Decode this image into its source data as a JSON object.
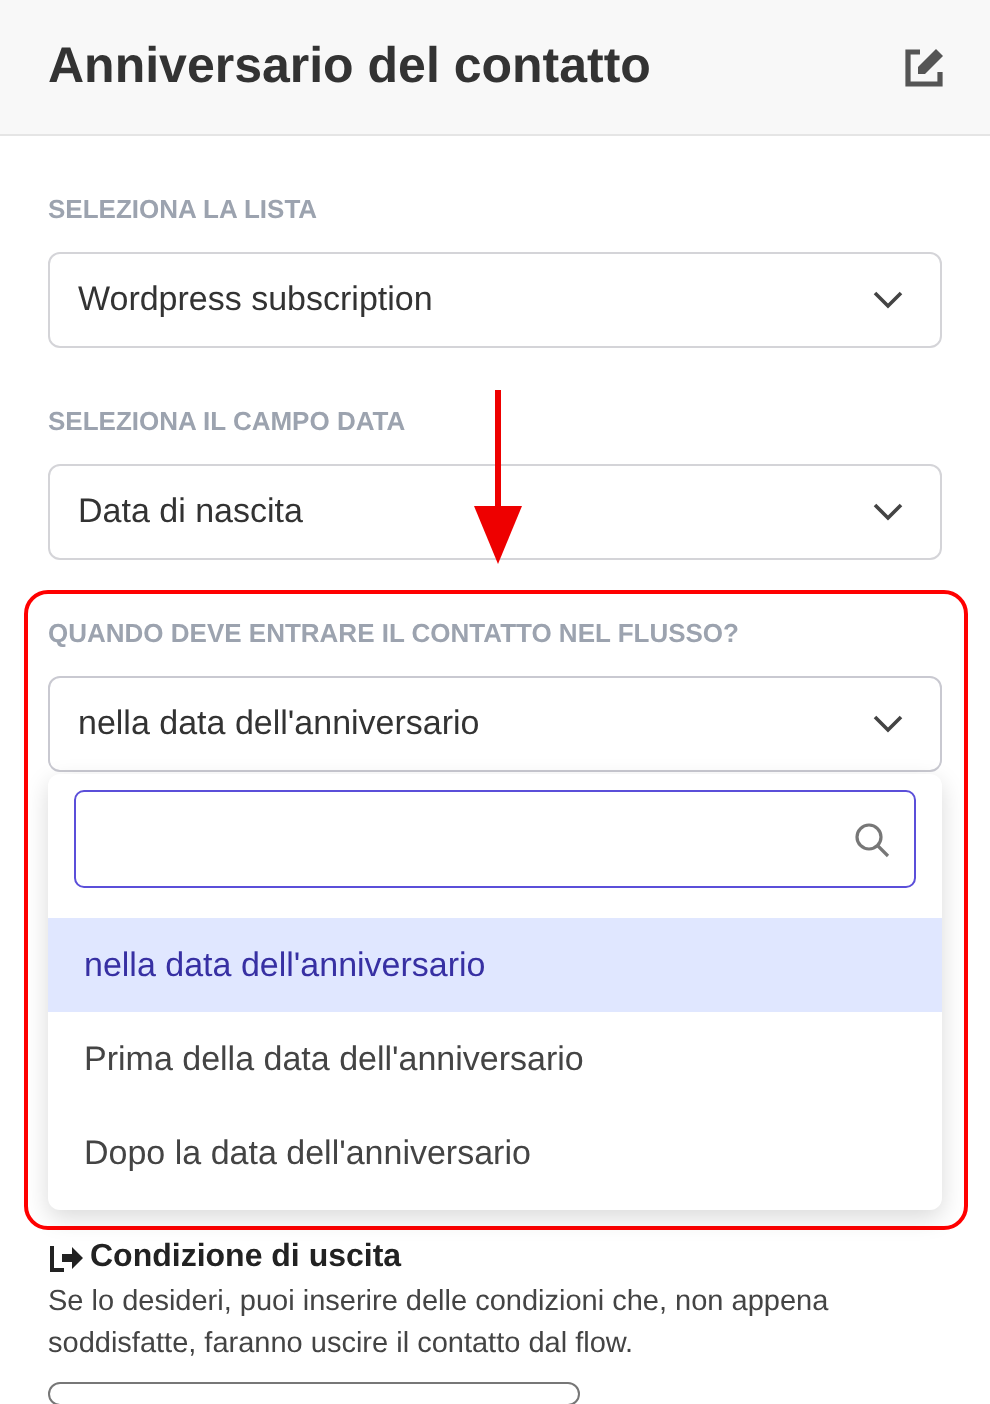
{
  "header": {
    "title": "Anniversario del contatto"
  },
  "fields": [
    {
      "label": "SELEZIONA LA LISTA",
      "value": "Wordpress subscription",
      "open": false,
      "highlighted": false
    },
    {
      "label": "SELEZIONA IL CAMPO DATA",
      "value": "Data di nascita",
      "open": false,
      "highlighted": false
    },
    {
      "label": "QUANDO DEVE ENTRARE IL CONTATTO NEL FLUSSO?",
      "value": "nella data dell'anniversario",
      "open": true,
      "highlighted": true
    }
  ],
  "dropdown_options": [
    {
      "label": "nella data dell'anniversario",
      "selected": true
    },
    {
      "label": "Prima della data dell'anniversario",
      "selected": false
    },
    {
      "label": "Dopo la data dell'anniversario",
      "selected": false
    }
  ],
  "exit_condition": {
    "title": "Condizione di uscita",
    "description": "Se lo desideri, puoi inserire delle condizioni che, non appena soddisfatte, faranno uscire il contatto dal flow."
  }
}
